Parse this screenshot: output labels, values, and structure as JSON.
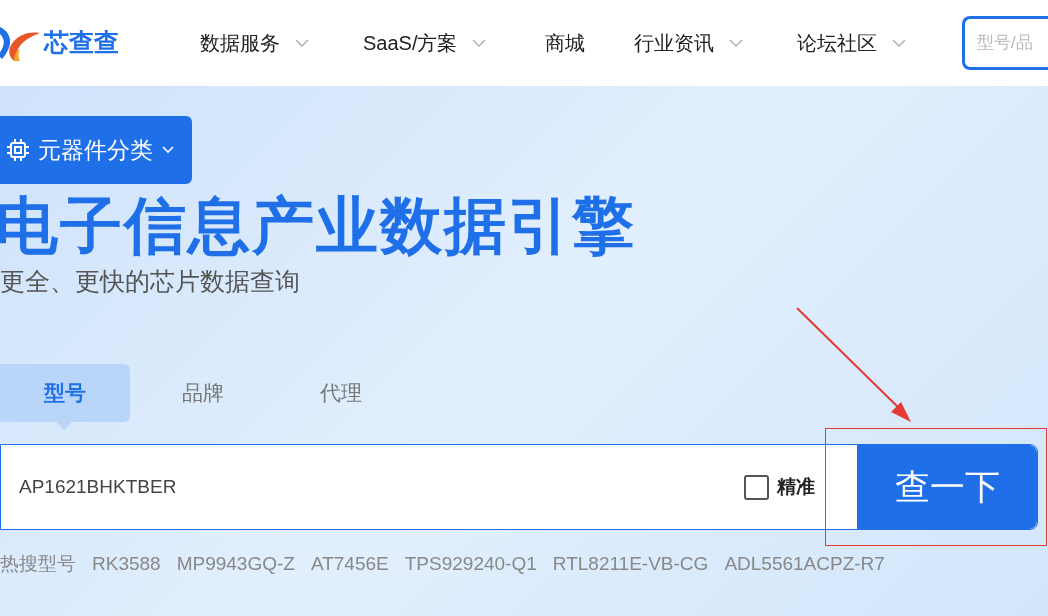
{
  "header": {
    "logo_text": "芯查查",
    "nav": [
      {
        "label": "数据服务",
        "has_dropdown": true
      },
      {
        "label": "SaaS/方案",
        "has_dropdown": true
      },
      {
        "label": "商城",
        "has_dropdown": false
      },
      {
        "label": "行业资讯",
        "has_dropdown": true
      },
      {
        "label": "论坛社区",
        "has_dropdown": true
      }
    ],
    "search": {
      "placeholder": "型号/品"
    }
  },
  "hero": {
    "category_button": "元器件分类",
    "title": "电子信息产业数据引擎",
    "subtitle": "更全、更快的芯片数据查询",
    "tabs": [
      {
        "label": "型号",
        "selected": true
      },
      {
        "label": "品牌",
        "selected": false
      },
      {
        "label": "代理",
        "selected": false
      }
    ],
    "search": {
      "value": "AP1621BHKTBER",
      "exact_label": "精准",
      "exact_checked": false,
      "button": "查一下"
    },
    "hot": {
      "label": "热搜型号",
      "items": [
        "RK3588",
        "MP9943GQ-Z",
        "AT7456E",
        "TPS929240-Q1",
        "RTL8211E-VB-CG",
        "ADL5561ACPZ-R7"
      ]
    }
  }
}
